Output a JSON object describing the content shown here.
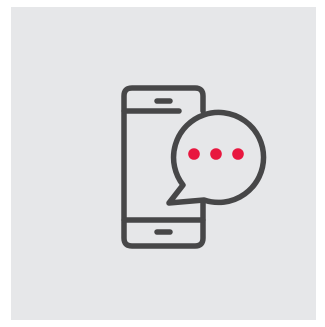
{
  "canvas": {
    "outer_background": "#ffffff",
    "tile_background": "#e6e7e9"
  },
  "icon": {
    "name": "mobile-chat-icon",
    "parts": [
      "smartphone-icon",
      "speech-bubble-icon",
      "typing-dots"
    ],
    "stroke_color": "#474748",
    "dot_color": "#e8173f",
    "dot_count": 3
  }
}
